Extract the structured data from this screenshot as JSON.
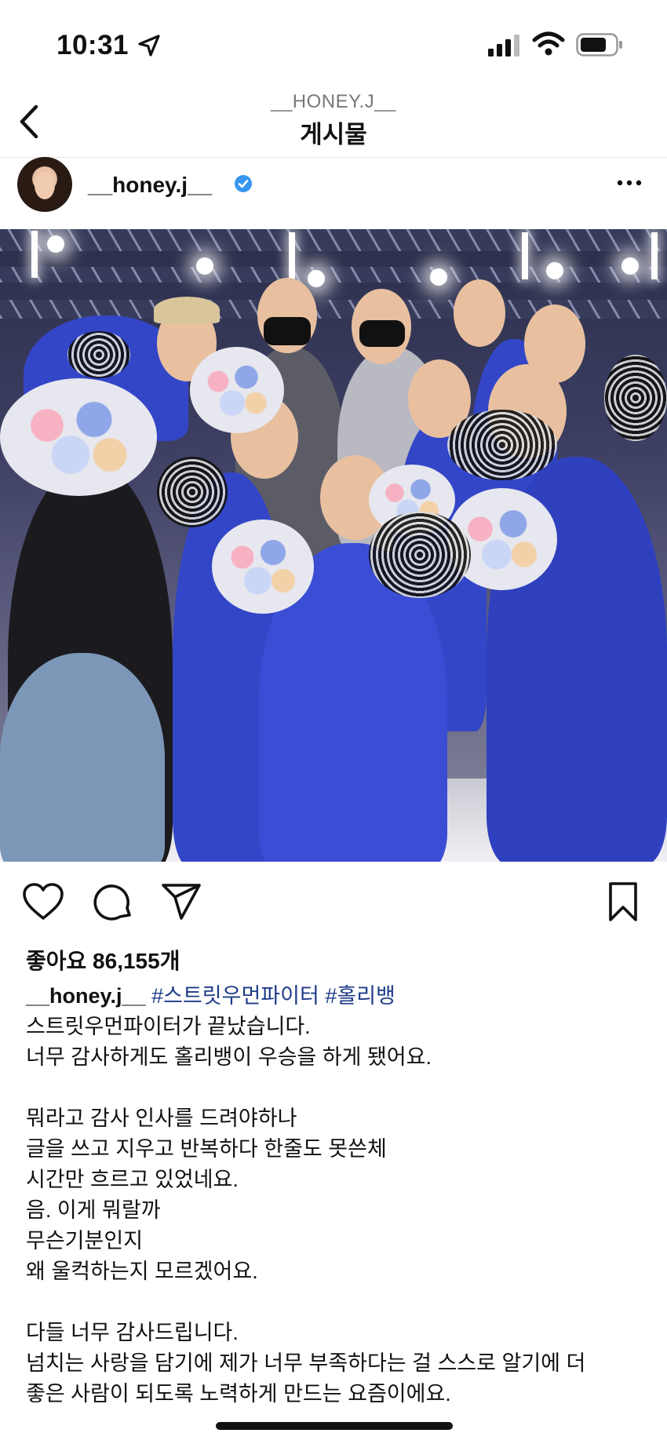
{
  "status_bar": {
    "time": "10:31"
  },
  "nav": {
    "subtitle": "__HONEY.J__",
    "title": "게시물"
  },
  "post": {
    "username": "__honey.j__",
    "likes_text": "좋아요 86,155개",
    "caption": {
      "username": "__honey.j__",
      "hashtags": [
        "#스트릿우먼파이터",
        "#홀리뱅"
      ],
      "lines": [
        "스트릿우먼파이터가 끝났습니다.",
        "너무 감사하게도 홀리뱅이 우승을 하게 됐어요.",
        "",
        "뭐라고 감사 인사를 드려야하나",
        "글을 쓰고 지우고 반복하다 한줄도 못쓴체",
        "시간만 흐르고 있었네요.",
        "음. 이게 뭐랄까",
        "무슨기분인지",
        "왜 울컥하는지 모르겠어요.",
        "",
        "다들 너무 감사드립니다.",
        "넘치는 사랑을 담기에 제가 너무 부족하다는 걸 스스로 알기에 더",
        "좋은 사람이 되도록 노력하게 만드는 요즘이에요."
      ]
    }
  },
  "colors": {
    "verified": "#3897f0",
    "hashtag": "#1f3c88",
    "stage_blue": "#3346c8"
  },
  "icons": [
    "location-arrow-icon",
    "signal-icon",
    "wifi-icon",
    "battery-icon",
    "back-chevron-icon",
    "verified-badge-icon",
    "more-dots-icon",
    "heart-icon",
    "comment-icon",
    "share-icon",
    "bookmark-icon"
  ]
}
